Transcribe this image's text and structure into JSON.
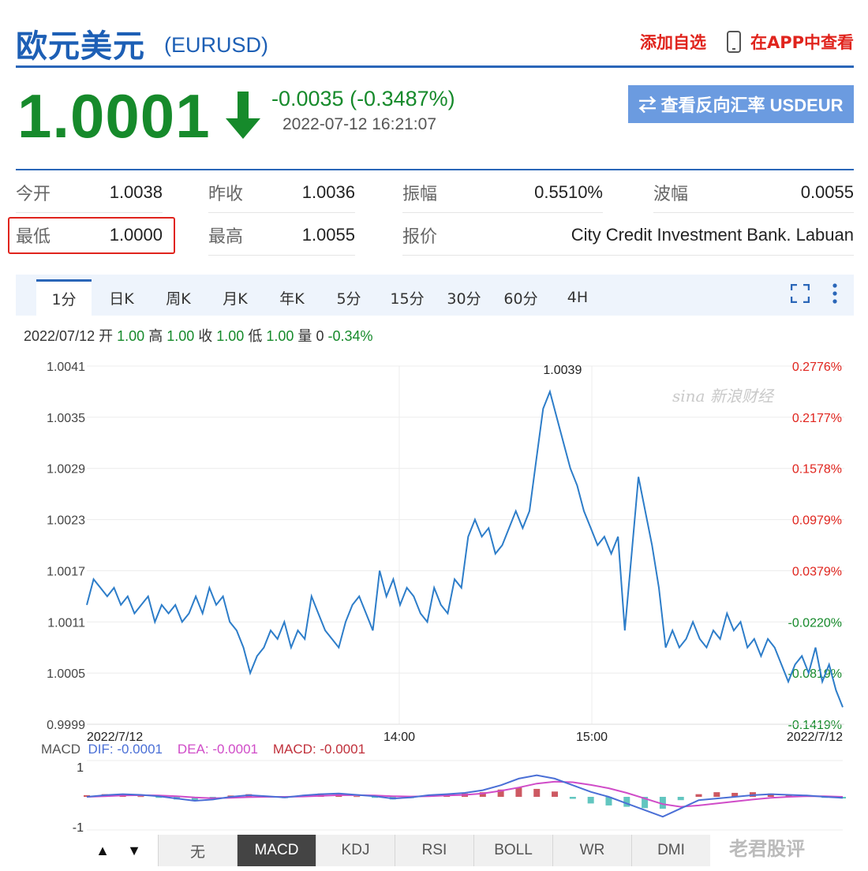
{
  "header": {
    "title": "欧元美元",
    "code": "(EURUSD)",
    "add_favorite": "添加自选",
    "view_in_app": "在APP中查看"
  },
  "quote": {
    "price": "1.0001",
    "change": "-0.0035 (-0.3487%)",
    "timestamp": "2022-07-12 16:21:07",
    "reverse_button": "⇄ 查看反向汇率 USDEUR",
    "down_color": "#168a2b"
  },
  "stats": [
    {
      "label": "今开",
      "value": "1.0038"
    },
    {
      "label": "昨收",
      "value": "1.0036"
    },
    {
      "label": "振幅",
      "value": "0.5510%"
    },
    {
      "label": "波幅",
      "value": "0.0055"
    },
    {
      "label": "最低",
      "value": "1.0000"
    },
    {
      "label": "最高",
      "value": "1.0055"
    },
    {
      "label": "报价",
      "value": "City Credit Investment Bank. Labuan"
    }
  ],
  "tabs": [
    "1分",
    "日K",
    "周K",
    "月K",
    "年K",
    "5分",
    "15分",
    "30分",
    "60分",
    "4H"
  ],
  "active_tab": 0,
  "ohlc_bar": {
    "date": "2022/07/12",
    "open_label": "开",
    "open": "1.00",
    "high_label": "高",
    "high": "1.00",
    "close_label": "收",
    "close": "1.00",
    "low_label": "低",
    "low": "1.00",
    "volume_label": "量",
    "volume": "0",
    "change_pct": "-0.34%"
  },
  "watermark_sina": "sina 新浪财经",
  "chart_data": {
    "type": "line",
    "title": "",
    "y_ticks": [
      "1.0041",
      "1.0035",
      "1.0029",
      "1.0023",
      "1.0017",
      "1.0011",
      "1.0005",
      "0.9999"
    ],
    "pct_ticks": [
      "0.2776%",
      "0.2177%",
      "0.1578%",
      "0.0979%",
      "0.0379%",
      "-0.0220%",
      "-0.0819%",
      "-0.1419%"
    ],
    "x_labels": [
      "2022/7/12",
      "14:00",
      "15:00",
      "2022/7/12"
    ],
    "peak_label": "1.0039",
    "ylim": [
      0.9999,
      1.0041
    ],
    "values": [
      1.0013,
      1.0016,
      1.0015,
      1.0014,
      1.0015,
      1.0013,
      1.0014,
      1.0012,
      1.0013,
      1.0014,
      1.0011,
      1.0013,
      1.0012,
      1.0013,
      1.0011,
      1.0012,
      1.0014,
      1.0012,
      1.0015,
      1.0013,
      1.0014,
      1.0011,
      1.001,
      1.0008,
      1.0005,
      1.0007,
      1.0008,
      1.001,
      1.0009,
      1.0011,
      1.0008,
      1.001,
      1.0009,
      1.0014,
      1.0012,
      1.001,
      1.0009,
      1.0008,
      1.0011,
      1.0013,
      1.0014,
      1.0012,
      1.001,
      1.0017,
      1.0014,
      1.0016,
      1.0013,
      1.0015,
      1.0014,
      1.0012,
      1.0011,
      1.0015,
      1.0013,
      1.0012,
      1.0016,
      1.0015,
      1.0021,
      1.0023,
      1.0021,
      1.0022,
      1.0019,
      1.002,
      1.0022,
      1.0024,
      1.0022,
      1.0024,
      1.003,
      1.0036,
      1.0038,
      1.0035,
      1.0032,
      1.0029,
      1.0027,
      1.0024,
      1.0022,
      1.002,
      1.0021,
      1.0019,
      1.0021,
      1.001,
      1.0019,
      1.0028,
      1.0024,
      1.002,
      1.0015,
      1.0008,
      1.001,
      1.0008,
      1.0009,
      1.0011,
      1.0009,
      1.0008,
      1.001,
      1.0009,
      1.0012,
      1.001,
      1.0011,
      1.0008,
      1.0009,
      1.0007,
      1.0009,
      1.0008,
      1.0006,
      1.0004,
      1.0006,
      1.0007,
      1.0005,
      1.0008,
      1.0004,
      1.0006,
      1.0003,
      1.0001
    ]
  },
  "macd": {
    "label": "MACD",
    "dif_label": "DIF: -0.0001",
    "dea_label": "DEA: -0.0001",
    "macd_label": "MACD: -0.0001",
    "dif_color": "#4a6fd6",
    "dea_color": "#d04cc8",
    "macd_color": "#c0303b",
    "y_top": "1",
    "y_bottom": "-1",
    "dif": [
      0.0,
      0.05,
      0.08,
      0.06,
      0.02,
      -0.05,
      -0.12,
      -0.08,
      0.0,
      0.05,
      0.02,
      -0.02,
      0.04,
      0.08,
      0.1,
      0.06,
      0.02,
      -0.05,
      -0.02,
      0.05,
      0.08,
      0.12,
      0.2,
      0.35,
      0.55,
      0.65,
      0.55,
      0.35,
      0.15,
      0.0,
      -0.2,
      -0.4,
      -0.6,
      -0.35,
      -0.1,
      -0.05,
      0.0,
      0.05,
      0.08,
      0.06,
      0.04,
      0.0,
      -0.03
    ],
    "dea": [
      0.0,
      0.02,
      0.04,
      0.05,
      0.04,
      0.02,
      -0.02,
      -0.04,
      -0.03,
      -0.01,
      0.0,
      0.0,
      0.01,
      0.03,
      0.05,
      0.05,
      0.04,
      0.02,
      0.01,
      0.02,
      0.04,
      0.06,
      0.1,
      0.18,
      0.28,
      0.4,
      0.46,
      0.44,
      0.36,
      0.26,
      0.12,
      -0.05,
      -0.22,
      -0.3,
      -0.26,
      -0.2,
      -0.14,
      -0.08,
      -0.03,
      0.0,
      0.02,
      0.02,
      0.0
    ],
    "hist": [
      0.05,
      0.08,
      0.06,
      0.02,
      -0.03,
      -0.08,
      -0.12,
      -0.06,
      0.04,
      0.08,
      0.03,
      -0.04,
      0.05,
      0.1,
      0.08,
      0.02,
      -0.03,
      -0.08,
      -0.04,
      0.06,
      0.08,
      0.1,
      0.14,
      0.22,
      0.28,
      0.24,
      0.16,
      -0.06,
      -0.2,
      -0.26,
      -0.3,
      -0.34,
      -0.36,
      -0.1,
      0.08,
      0.14,
      0.12,
      0.14,
      0.1,
      0.07,
      0.04,
      -0.03,
      -0.05
    ]
  },
  "indicator_nav": {
    "prev": "▲",
    "next": "▼"
  },
  "indicators": [
    "无",
    "MACD",
    "KDJ",
    "RSI",
    "BOLL",
    "WR",
    "DMI"
  ],
  "active_indicator": 1,
  "watermark_weibo": "老君股评"
}
